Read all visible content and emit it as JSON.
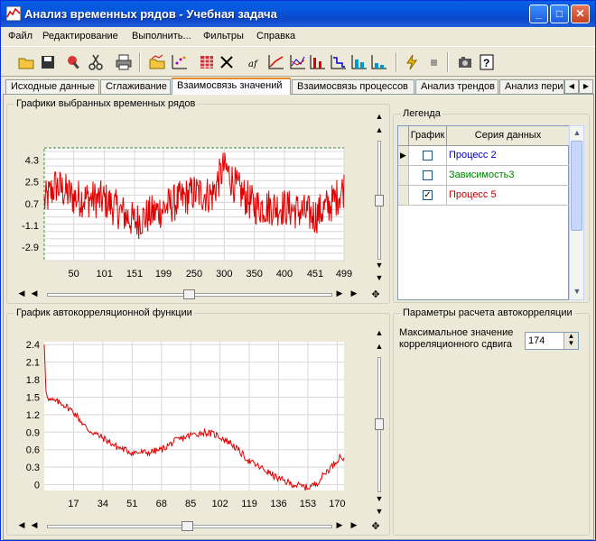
{
  "window": {
    "title": "Анализ временных рядов - Учебная задача",
    "minimize": "_",
    "maximize": "□",
    "close": "✕"
  },
  "menu": [
    "Файл",
    "Редактирование",
    "Выполнить...",
    "Фильтры",
    "Справка"
  ],
  "toolbar": {
    "icons": [
      "open-folder-icon",
      "save-disk-icon",
      "settings-tool-icon",
      "cut-scissors-icon",
      "print-icon",
      "folder-chart-icon",
      "scatter-icon",
      "grid-table-icon",
      "delete-x-icon",
      "formula-af-icon",
      "line-chart-icon",
      "multi-line-icon",
      "bar-chart-icon",
      "step-chart-icon",
      "bar-blue-icon",
      "bar-low-icon",
      "run-lightning-icon",
      "stop-square-icon",
      "camera-icon",
      "help-icon"
    ]
  },
  "tabs": [
    {
      "label": "Исходные данные"
    },
    {
      "label": "Сглаживание"
    },
    {
      "label": "Взаимосвязь значений",
      "active": true
    },
    {
      "label": "Взаимосвязь процессов"
    },
    {
      "label": "Анализ трендов"
    },
    {
      "label": "Анализ пери"
    }
  ],
  "series_group": {
    "title": "Графики выбранных временных рядов"
  },
  "legend": {
    "title": "Легенда",
    "col_plot": "График",
    "col_series": "Серия данных",
    "rows": [
      {
        "name": "Процесс 2",
        "checked": false,
        "color": "#0000c0",
        "current": true
      },
      {
        "name": "Зависимость3",
        "checked": false,
        "color": "#008000",
        "current": false
      },
      {
        "name": "Процесс 5",
        "checked": true,
        "color": "#c00000",
        "current": false
      }
    ]
  },
  "acf_group": {
    "title": "График автокорреляционной функции"
  },
  "params": {
    "title": "Параметры расчета автокорреляции",
    "label_line1": "Максимальное значение",
    "label_line2": "корреляционного сдвига",
    "value": "174"
  },
  "chart_data": [
    {
      "type": "line",
      "title": "",
      "series": [
        {
          "name": "Процесс 5",
          "color": "#e00000"
        }
      ],
      "x_ticks": [
        50,
        101,
        151,
        199,
        250,
        300,
        350,
        400,
        451,
        499
      ],
      "y_ticks": [
        4.3,
        2.5,
        0.7,
        -1.1,
        -2.9
      ],
      "xlim": [
        1,
        499
      ],
      "ylim": [
        -4.0,
        5.3
      ],
      "grid": true,
      "envelope": [
        [
          1,
          0.8
        ],
        [
          20,
          2.2
        ],
        [
          50,
          1.2
        ],
        [
          101,
          1.0
        ],
        [
          151,
          -0.8
        ],
        [
          199,
          0.3
        ],
        [
          250,
          1.6
        ],
        [
          280,
          1.4
        ],
        [
          300,
          3.8
        ],
        [
          320,
          2.0
        ],
        [
          350,
          0.5
        ],
        [
          400,
          0.4
        ],
        [
          451,
          -0.3
        ],
        [
          480,
          0.8
        ],
        [
          499,
          2.0
        ]
      ]
    },
    {
      "type": "line",
      "title": "",
      "series": [
        {
          "name": "",
          "color": "#e00000"
        }
      ],
      "x_ticks": [
        17,
        34,
        51,
        68,
        85,
        102,
        119,
        136,
        153,
        170
      ],
      "y_ticks": [
        2.4,
        2.1,
        1.8,
        1.5,
        1.2,
        0.9,
        0.6,
        0.3,
        -0.0
      ],
      "xlim": [
        0,
        174
      ],
      "ylim": [
        -0.1,
        2.45
      ],
      "grid": true,
      "points": [
        [
          0,
          2.4
        ],
        [
          1,
          1.6
        ],
        [
          3,
          1.45
        ],
        [
          10,
          1.4
        ],
        [
          17,
          1.25
        ],
        [
          25,
          0.95
        ],
        [
          34,
          0.8
        ],
        [
          42,
          0.65
        ],
        [
          51,
          0.55
        ],
        [
          60,
          0.55
        ],
        [
          68,
          0.6
        ],
        [
          76,
          0.75
        ],
        [
          85,
          0.85
        ],
        [
          93,
          0.9
        ],
        [
          100,
          0.85
        ],
        [
          108,
          0.72
        ],
        [
          114,
          0.55
        ],
        [
          119,
          0.4
        ],
        [
          128,
          0.25
        ],
        [
          136,
          0.1
        ],
        [
          145,
          0.0
        ],
        [
          153,
          -0.05
        ],
        [
          158,
          0.02
        ],
        [
          163,
          0.2
        ],
        [
          168,
          0.35
        ],
        [
          172,
          0.5
        ],
        [
          174,
          0.42
        ]
      ]
    }
  ]
}
